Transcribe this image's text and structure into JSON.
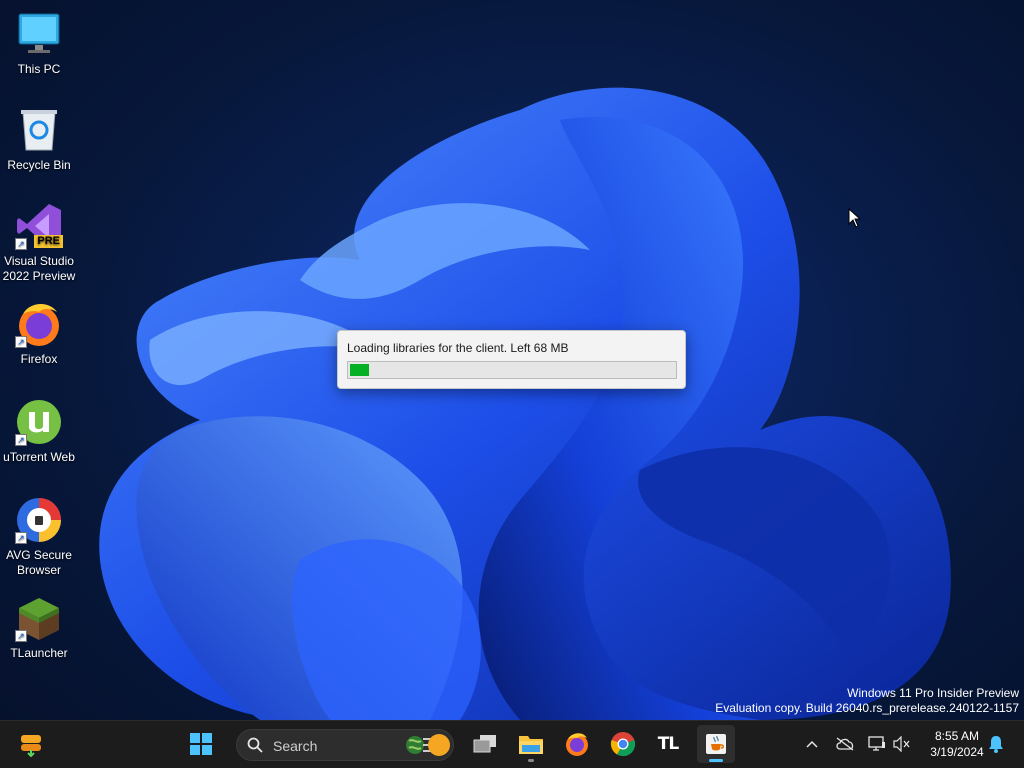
{
  "desktop": {
    "icons": [
      {
        "label": "This PC"
      },
      {
        "label": "Recycle Bin"
      },
      {
        "label": "Visual Studio 2022 Preview"
      },
      {
        "label": "Firefox"
      },
      {
        "label": "uTorrent Web"
      },
      {
        "label": "AVG Secure Browser"
      },
      {
        "label": "TLauncher"
      }
    ],
    "vs_badge": "PRE"
  },
  "dialog": {
    "message": "Loading libraries for the client. Left 68 MB",
    "progress_fraction": 0.06,
    "progress_color": "#06b025"
  },
  "watermark": {
    "line1": "Windows 11 Pro Insider Preview",
    "line2": "Evaluation copy. Build 26040.rs_prerelease.240122-1157"
  },
  "taskbar": {
    "search_label": "Search",
    "apps": [
      "task-view",
      "file-explorer",
      "firefox",
      "chrome",
      "tlauncher",
      "java"
    ],
    "tlauncher_text": "TL",
    "clock_time": "8:55 AM",
    "clock_date": "3/19/2024"
  }
}
